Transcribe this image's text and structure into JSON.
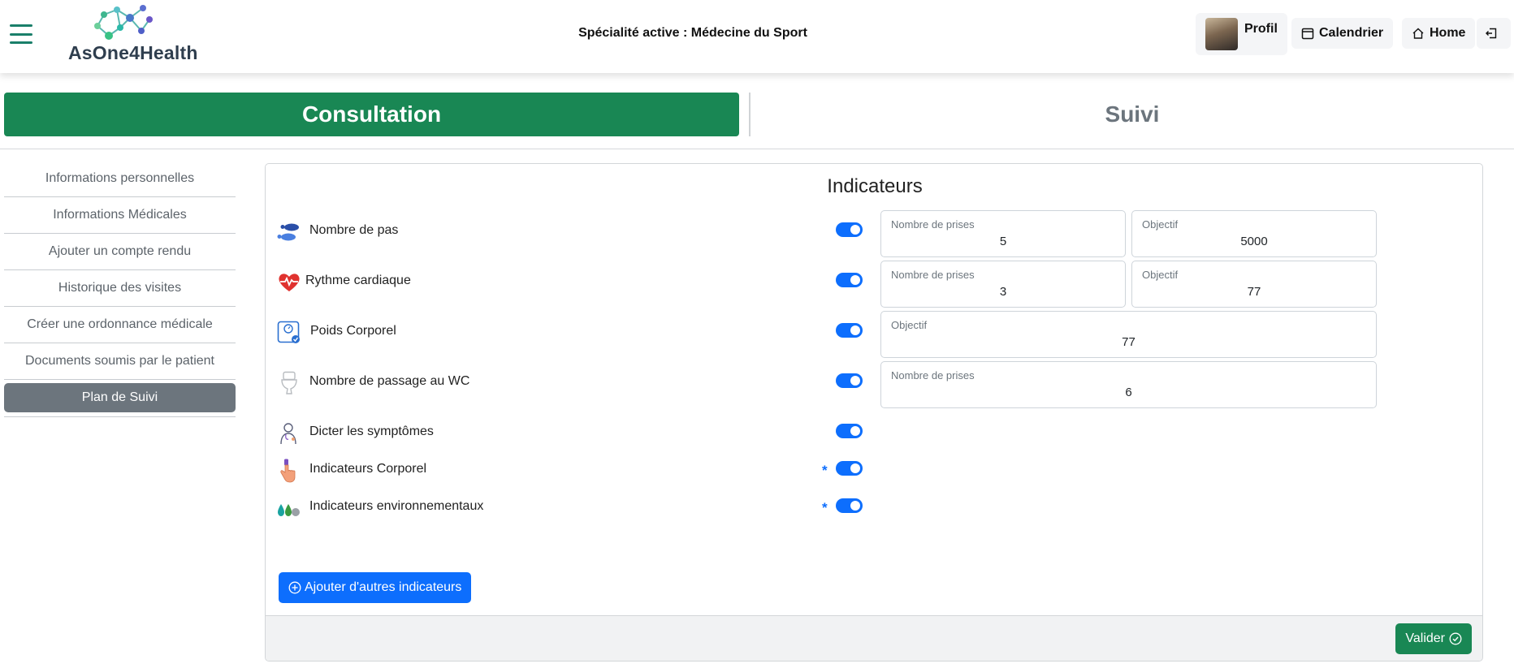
{
  "header": {
    "logo_text": "AsOne4Health",
    "specialty": "Spécialité active : Médecine du Sport",
    "profile_label": "Profil",
    "calendar_label": "Calendrier",
    "home_label": "Home"
  },
  "tabs": {
    "consultation": "Consultation",
    "suivi": "Suivi"
  },
  "sidebar": {
    "items": [
      {
        "label": "Informations personnelles"
      },
      {
        "label": "Informations Médicales"
      },
      {
        "label": "Ajouter un compte rendu"
      },
      {
        "label": "Historique des visites"
      },
      {
        "label": "Créer une ordonnance médicale"
      },
      {
        "label": "Documents soumis par le patient"
      },
      {
        "label": "Plan de Suivi",
        "active": true
      }
    ]
  },
  "indicators": {
    "title": "Indicateurs",
    "items": [
      {
        "label": "Nombre de pas",
        "icon": "footsteps-icon",
        "enabled": true,
        "fields": [
          {
            "label": "Nombre de prises",
            "value": "5"
          },
          {
            "label": "Objectif",
            "value": "5000"
          }
        ]
      },
      {
        "label": "Rythme cardiaque",
        "icon": "heart-rate-icon",
        "enabled": true,
        "fields": [
          {
            "label": "Nombre de prises",
            "value": "3"
          },
          {
            "label": "Objectif",
            "value": "77"
          }
        ]
      },
      {
        "label": "Poids Corporel",
        "icon": "weight-scale-icon",
        "enabled": true,
        "fields": [
          {
            "label": "Objectif",
            "value": "77"
          }
        ]
      },
      {
        "label": "Nombre de passage au WC",
        "icon": "toilet-icon",
        "enabled": true,
        "fields": [
          {
            "label": "Nombre de prises",
            "value": "6"
          }
        ]
      },
      {
        "label": "Dicter les symptômes",
        "icon": "doctor-icon",
        "enabled": true
      },
      {
        "label": "Indicateurs Corporel",
        "icon": "finger-sensor-icon",
        "enabled": true,
        "required_mark": "*"
      },
      {
        "label": "Indicateurs environnementaux",
        "icon": "water-drops-icon",
        "enabled": true,
        "required_mark": "*"
      }
    ],
    "add_button": "Ajouter d'autres indicateurs",
    "submit_button": "Valider"
  },
  "colors": {
    "primary": "#0d6efd",
    "success": "#198754",
    "secondary": "#6c757d",
    "logo_teal": "#1a7f6a"
  }
}
